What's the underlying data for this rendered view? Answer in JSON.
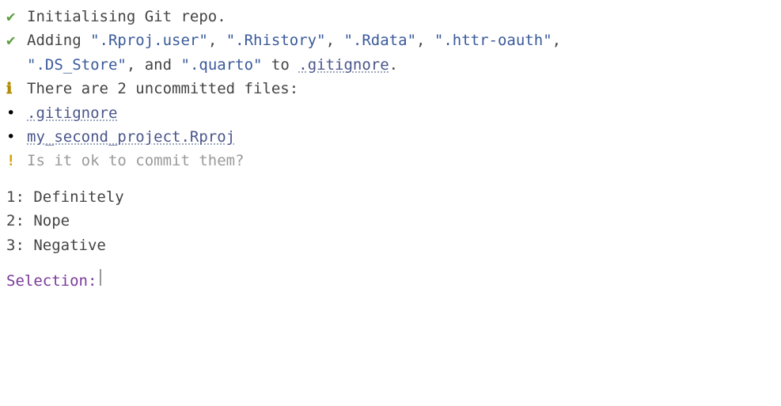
{
  "msg": {
    "init": "Initialising Git repo.",
    "adding_pre": "Adding ",
    "adding_items": [
      ".Rproj.user",
      ".Rhistory",
      ".Rdata",
      ".httr-oauth",
      ".DS_Store",
      ".quarto"
    ],
    "adding_mid": ", and ",
    "adding_post_1": " to ",
    "adding_target": ".gitignore",
    "adding_post_2": ".",
    "uncommitted": "There are 2 uncommitted files:",
    "file1": ".gitignore",
    "file2": "my_second_project.Rproj",
    "question": "Is it ok to commit them?"
  },
  "options": {
    "opt1_num": "1:",
    "opt1_label": "Definitely",
    "opt2_num": "2:",
    "opt2_label": "Nope",
    "opt3_num": "3:",
    "opt3_label": "Negative"
  },
  "prompt": {
    "label": "Selection: "
  },
  "icons": {
    "check": "✔",
    "info": "ℹ",
    "bullet": "•",
    "bang": "!"
  }
}
